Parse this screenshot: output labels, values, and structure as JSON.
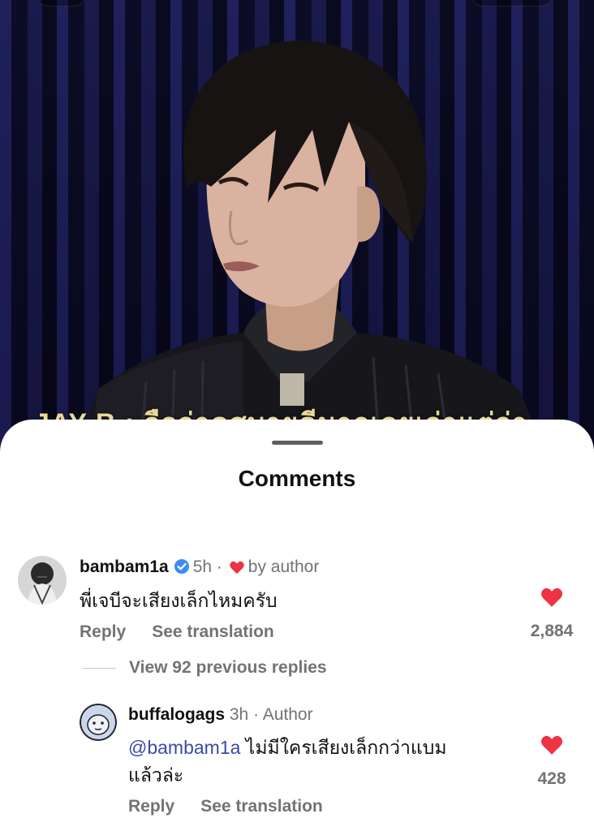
{
  "video": {
    "caption": "JAY B : ถือว่าดูสบายดีมากเลยเว่าแต่ว่า"
  },
  "sheet": {
    "title": "Comments"
  },
  "comments": [
    {
      "username": "bambam1a",
      "verified": true,
      "time": "5h",
      "separator": "·",
      "by_author": "by author",
      "text": "พี่เจบีจะเสียงเล็กไหมครับ",
      "reply_label": "Reply",
      "translate_label": "See translation",
      "likes": "2,884"
    }
  ],
  "view_replies": "View 92 previous replies",
  "reply": {
    "username": "buffalogags",
    "time": "3h",
    "separator": "·",
    "author_badge": "Author",
    "mention": "@bambam1a",
    "text_line1": " ไม่มีใครเสียงเล็กกว่าแบม",
    "text_line2": "แล้วล่ะ",
    "reply_label": "Reply",
    "translate_label": "See translation",
    "likes": "428"
  },
  "colors": {
    "heart": "#ed3344",
    "verified": "#3b8ef0",
    "mention": "#3a4aa8",
    "muted": "#737373"
  }
}
